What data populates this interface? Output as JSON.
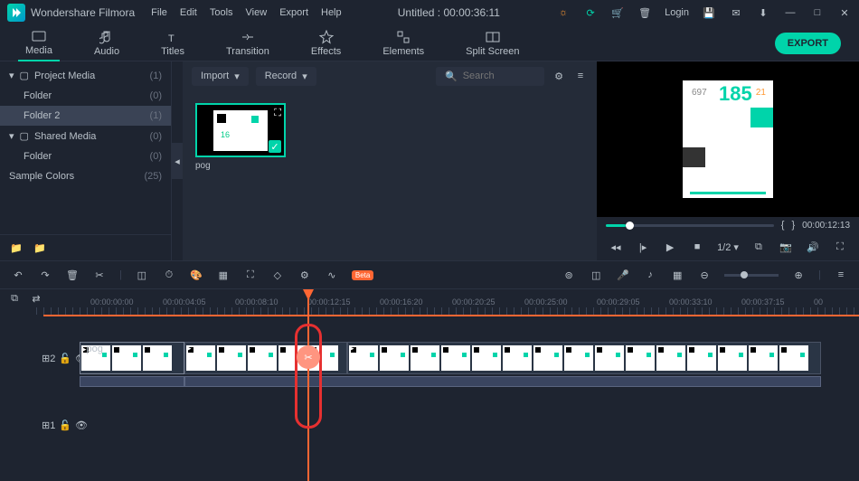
{
  "titlebar": {
    "app_name": "Wondershare Filmora",
    "menus": [
      "File",
      "Edit",
      "Tools",
      "View",
      "Export",
      "Help"
    ],
    "doc_title": "Untitled : 00:00:36:11",
    "login": "Login"
  },
  "tabs": [
    {
      "icon": "folder",
      "label": "Media"
    },
    {
      "icon": "audio",
      "label": "Audio"
    },
    {
      "icon": "text",
      "label": "Titles"
    },
    {
      "icon": "transition",
      "label": "Transition"
    },
    {
      "icon": "effects",
      "label": "Effects"
    },
    {
      "icon": "elements",
      "label": "Elements"
    },
    {
      "icon": "split",
      "label": "Split Screen"
    }
  ],
  "export_label": "EXPORT",
  "sidebar": {
    "items": [
      {
        "label": "Project Media",
        "count": "(1)",
        "expandable": true
      },
      {
        "label": "Folder",
        "count": "(0)",
        "sub": true
      },
      {
        "label": "Folder 2",
        "count": "(1)",
        "sub": true,
        "active": true
      },
      {
        "label": "Shared Media",
        "count": "(0)",
        "expandable": true
      },
      {
        "label": "Folder",
        "count": "(0)",
        "sub": true
      },
      {
        "label": "Sample Colors",
        "count": "(25)"
      }
    ]
  },
  "media_toolbar": {
    "import": "Import",
    "record": "Record",
    "search_placeholder": "Search"
  },
  "clips": [
    {
      "name": "pog"
    }
  ],
  "preview": {
    "big_num": "185",
    "num_left": "697",
    "num_right": "21",
    "braces_left": "{",
    "braces_right": "}",
    "time": "00:00:12:13",
    "speed": "1/2"
  },
  "ruler": [
    "00:00:00:00",
    "00:00:04:05",
    "00:00:08:10",
    "00:00:12:15",
    "00:00:16:20",
    "00:00:20:25",
    "00:00:25:00",
    "00:00:29:05",
    "00:00:33:10",
    "00:00:37:15",
    "00"
  ],
  "track_labels": {
    "t1": "1",
    "t2": "2"
  },
  "clip_label": "pog",
  "beta": "Beta"
}
